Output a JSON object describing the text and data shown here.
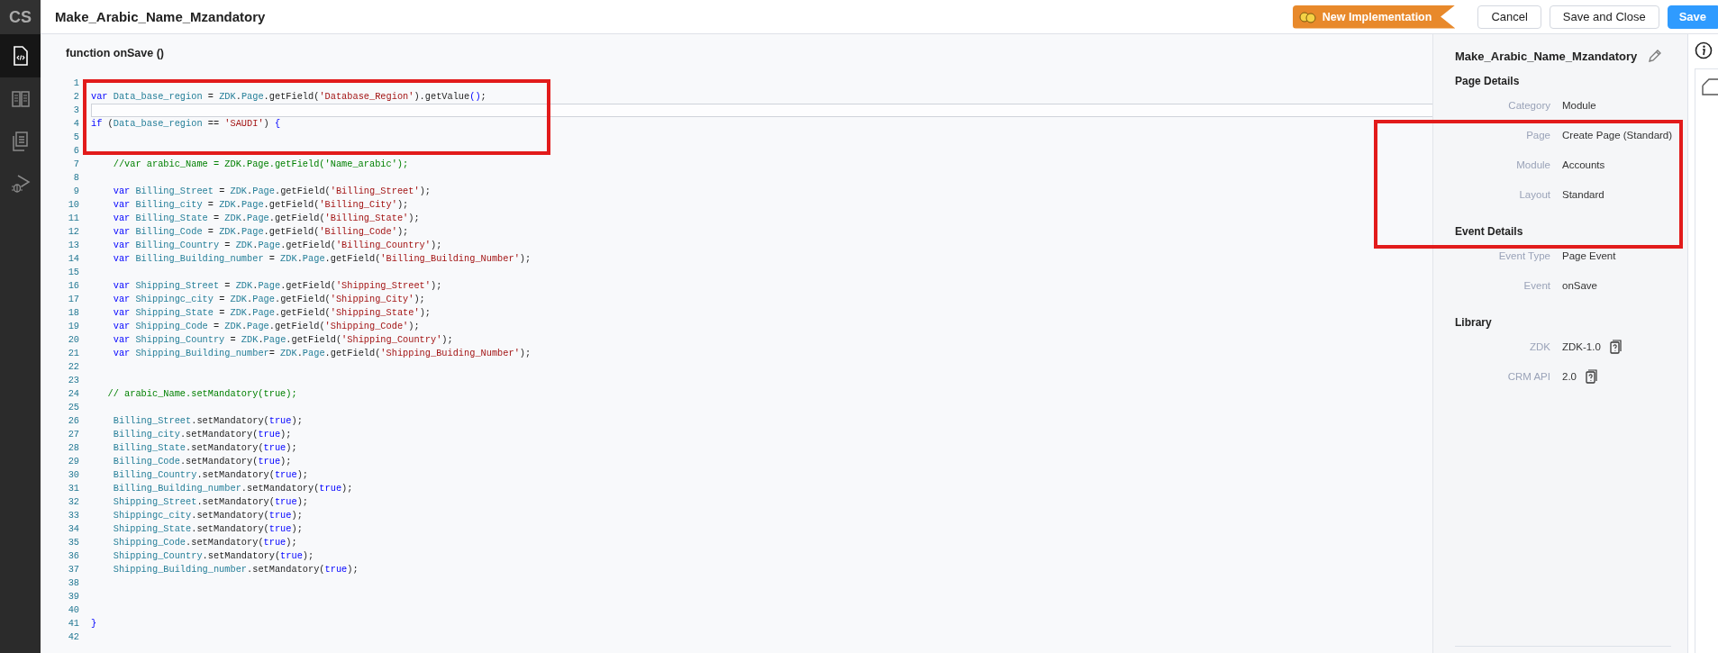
{
  "sidebar": {
    "logo": "CS",
    "items": [
      {
        "selected": true
      },
      {
        "selected": false
      },
      {
        "selected": false
      },
      {
        "selected": false
      }
    ]
  },
  "header": {
    "title": "Make_Arabic_Name_Mzandatory",
    "badge": "New Implementation",
    "buttons": [
      {
        "label": "Cancel",
        "kind": "secondary"
      },
      {
        "label": "Save and Close",
        "kind": "secondary"
      },
      {
        "label": "Save",
        "kind": "primary"
      }
    ]
  },
  "editor": {
    "signature": "function onSave ()",
    "lines": [
      {
        "number": "1",
        "active": false
      },
      {
        "number": "2",
        "active": false,
        "tokens": [
          {
            "kind": "keyword",
            "text": "var "
          },
          {
            "kind": "name",
            "text": "Data_base_region"
          },
          {
            "kind": "plain",
            "text": " = "
          },
          {
            "kind": "name",
            "text": "ZDK"
          },
          {
            "kind": "plain",
            "text": "."
          },
          {
            "kind": "name",
            "text": "Page"
          },
          {
            "kind": "plain",
            "text": ".getField("
          },
          {
            "kind": "string",
            "text": "'Database_Region'"
          },
          {
            "kind": "plain",
            "text": ").getValue"
          },
          {
            "kind": "keyword",
            "text": "()"
          },
          {
            "kind": "plain",
            "text": ";"
          }
        ]
      },
      {
        "number": "3",
        "active": true
      },
      {
        "number": "4",
        "active": false,
        "tokens": [
          {
            "kind": "keyword",
            "text": "if"
          },
          {
            "kind": "plain",
            "text": " ("
          },
          {
            "kind": "name",
            "text": "Data_base_region"
          },
          {
            "kind": "plain",
            "text": " == "
          },
          {
            "kind": "string",
            "text": "'SAUDI'"
          },
          {
            "kind": "plain",
            "text": ") "
          },
          {
            "kind": "keyword",
            "text": "{"
          }
        ]
      },
      {
        "number": "5",
        "active": false
      },
      {
        "number": "6",
        "active": false
      },
      {
        "number": "7",
        "active": false,
        "tokens": [
          {
            "kind": "comment",
            "text": "    //var arabic_Name = ZDK.Page.getField('Name_arabic');"
          }
        ]
      },
      {
        "number": "8",
        "active": false
      },
      {
        "number": "9",
        "active": false,
        "tokens": [
          {
            "kind": "keyword",
            "text": "    var "
          },
          {
            "kind": "name",
            "text": "Billing_Street"
          },
          {
            "kind": "plain",
            "text": " = "
          },
          {
            "kind": "name",
            "text": "ZDK"
          },
          {
            "kind": "plain",
            "text": "."
          },
          {
            "kind": "name",
            "text": "Page"
          },
          {
            "kind": "plain",
            "text": ".getField("
          },
          {
            "kind": "string",
            "text": "'Billing_Street'"
          },
          {
            "kind": "plain",
            "text": ");"
          }
        ]
      },
      {
        "number": "10",
        "active": false,
        "tokens": [
          {
            "kind": "keyword",
            "text": "    var "
          },
          {
            "kind": "name",
            "text": "Billing_city"
          },
          {
            "kind": "plain",
            "text": " = "
          },
          {
            "kind": "name",
            "text": "ZDK"
          },
          {
            "kind": "plain",
            "text": "."
          },
          {
            "kind": "name",
            "text": "Page"
          },
          {
            "kind": "plain",
            "text": ".getField("
          },
          {
            "kind": "string",
            "text": "'Billing_City'"
          },
          {
            "kind": "plain",
            "text": ");"
          }
        ]
      },
      {
        "number": "11",
        "active": false,
        "tokens": [
          {
            "kind": "keyword",
            "text": "    var "
          },
          {
            "kind": "name",
            "text": "Billing_State"
          },
          {
            "kind": "plain",
            "text": " = "
          },
          {
            "kind": "name",
            "text": "ZDK"
          },
          {
            "kind": "plain",
            "text": "."
          },
          {
            "kind": "name",
            "text": "Page"
          },
          {
            "kind": "plain",
            "text": ".getField("
          },
          {
            "kind": "string",
            "text": "'Billing_State'"
          },
          {
            "kind": "plain",
            "text": ");"
          }
        ]
      },
      {
        "number": "12",
        "active": false,
        "tokens": [
          {
            "kind": "keyword",
            "text": "    var "
          },
          {
            "kind": "name",
            "text": "Billing_Code"
          },
          {
            "kind": "plain",
            "text": " = "
          },
          {
            "kind": "name",
            "text": "ZDK"
          },
          {
            "kind": "plain",
            "text": "."
          },
          {
            "kind": "name",
            "text": "Page"
          },
          {
            "kind": "plain",
            "text": ".getField("
          },
          {
            "kind": "string",
            "text": "'Billing_Code'"
          },
          {
            "kind": "plain",
            "text": ");"
          }
        ]
      },
      {
        "number": "13",
        "active": false,
        "tokens": [
          {
            "kind": "keyword",
            "text": "    var "
          },
          {
            "kind": "name",
            "text": "Billing_Country"
          },
          {
            "kind": "plain",
            "text": " = "
          },
          {
            "kind": "name",
            "text": "ZDK"
          },
          {
            "kind": "plain",
            "text": "."
          },
          {
            "kind": "name",
            "text": "Page"
          },
          {
            "kind": "plain",
            "text": ".getField("
          },
          {
            "kind": "string",
            "text": "'Billing_Country'"
          },
          {
            "kind": "plain",
            "text": ");"
          }
        ]
      },
      {
        "number": "14",
        "active": false,
        "tokens": [
          {
            "kind": "keyword",
            "text": "    var "
          },
          {
            "kind": "name",
            "text": "Billing_Building_number"
          },
          {
            "kind": "plain",
            "text": " = "
          },
          {
            "kind": "name",
            "text": "ZDK"
          },
          {
            "kind": "plain",
            "text": "."
          },
          {
            "kind": "name",
            "text": "Page"
          },
          {
            "kind": "plain",
            "text": ".getField("
          },
          {
            "kind": "string",
            "text": "'Billing_Building_Number'"
          },
          {
            "kind": "plain",
            "text": ");"
          }
        ]
      },
      {
        "number": "15",
        "active": false
      },
      {
        "number": "16",
        "active": false,
        "tokens": [
          {
            "kind": "keyword",
            "text": "    var "
          },
          {
            "kind": "name",
            "text": "Shipping_Street"
          },
          {
            "kind": "plain",
            "text": " = "
          },
          {
            "kind": "name",
            "text": "ZDK"
          },
          {
            "kind": "plain",
            "text": "."
          },
          {
            "kind": "name",
            "text": "Page"
          },
          {
            "kind": "plain",
            "text": ".getField("
          },
          {
            "kind": "string",
            "text": "'Shipping_Street'"
          },
          {
            "kind": "plain",
            "text": ");"
          }
        ]
      },
      {
        "number": "17",
        "active": false,
        "tokens": [
          {
            "kind": "keyword",
            "text": "    var "
          },
          {
            "kind": "name",
            "text": "Shippingc_city"
          },
          {
            "kind": "plain",
            "text": " = "
          },
          {
            "kind": "name",
            "text": "ZDK"
          },
          {
            "kind": "plain",
            "text": "."
          },
          {
            "kind": "name",
            "text": "Page"
          },
          {
            "kind": "plain",
            "text": ".getField("
          },
          {
            "kind": "string",
            "text": "'Shipping_City'"
          },
          {
            "kind": "plain",
            "text": ");"
          }
        ]
      },
      {
        "number": "18",
        "active": false,
        "tokens": [
          {
            "kind": "keyword",
            "text": "    var "
          },
          {
            "kind": "name",
            "text": "Shipping_State"
          },
          {
            "kind": "plain",
            "text": " = "
          },
          {
            "kind": "name",
            "text": "ZDK"
          },
          {
            "kind": "plain",
            "text": "."
          },
          {
            "kind": "name",
            "text": "Page"
          },
          {
            "kind": "plain",
            "text": ".getField("
          },
          {
            "kind": "string",
            "text": "'Shipping_State'"
          },
          {
            "kind": "plain",
            "text": ");"
          }
        ]
      },
      {
        "number": "19",
        "active": false,
        "tokens": [
          {
            "kind": "keyword",
            "text": "    var "
          },
          {
            "kind": "name",
            "text": "Shipping_Code"
          },
          {
            "kind": "plain",
            "text": " = "
          },
          {
            "kind": "name",
            "text": "ZDK"
          },
          {
            "kind": "plain",
            "text": "."
          },
          {
            "kind": "name",
            "text": "Page"
          },
          {
            "kind": "plain",
            "text": ".getField("
          },
          {
            "kind": "string",
            "text": "'Shipping_Code'"
          },
          {
            "kind": "plain",
            "text": ");"
          }
        ]
      },
      {
        "number": "20",
        "active": false,
        "tokens": [
          {
            "kind": "keyword",
            "text": "    var "
          },
          {
            "kind": "name",
            "text": "Shipping_Country"
          },
          {
            "kind": "plain",
            "text": " = "
          },
          {
            "kind": "name",
            "text": "ZDK"
          },
          {
            "kind": "plain",
            "text": "."
          },
          {
            "kind": "name",
            "text": "Page"
          },
          {
            "kind": "plain",
            "text": ".getField("
          },
          {
            "kind": "string",
            "text": "'Shipping_Country'"
          },
          {
            "kind": "plain",
            "text": ");"
          }
        ]
      },
      {
        "number": "21",
        "active": false,
        "tokens": [
          {
            "kind": "keyword",
            "text": "    var "
          },
          {
            "kind": "name",
            "text": "Shipping_Building_number"
          },
          {
            "kind": "plain",
            "text": "= "
          },
          {
            "kind": "name",
            "text": "ZDK"
          },
          {
            "kind": "plain",
            "text": "."
          },
          {
            "kind": "name",
            "text": "Page"
          },
          {
            "kind": "plain",
            "text": ".getField("
          },
          {
            "kind": "string",
            "text": "'Shipping_Buiding_Number'"
          },
          {
            "kind": "plain",
            "text": ");"
          }
        ]
      },
      {
        "number": "22",
        "active": false
      },
      {
        "number": "23",
        "active": false
      },
      {
        "number": "24",
        "active": false,
        "tokens": [
          {
            "kind": "comment",
            "text": "   // arabic_Name.setMandatory(true);"
          }
        ]
      },
      {
        "number": "25",
        "active": false
      },
      {
        "number": "26",
        "active": false,
        "tokens": [
          {
            "kind": "name",
            "text": "    Billing_Street"
          },
          {
            "kind": "plain",
            "text": ".setMandatory("
          },
          {
            "kind": "keyword",
            "text": "true"
          },
          {
            "kind": "plain",
            "text": ");"
          }
        ]
      },
      {
        "number": "27",
        "active": false,
        "tokens": [
          {
            "kind": "name",
            "text": "    Billing_city"
          },
          {
            "kind": "plain",
            "text": ".setMandatory("
          },
          {
            "kind": "keyword",
            "text": "true"
          },
          {
            "kind": "plain",
            "text": ");"
          }
        ]
      },
      {
        "number": "28",
        "active": false,
        "tokens": [
          {
            "kind": "name",
            "text": "    Billing_State"
          },
          {
            "kind": "plain",
            "text": ".setMandatory("
          },
          {
            "kind": "keyword",
            "text": "true"
          },
          {
            "kind": "plain",
            "text": ");"
          }
        ]
      },
      {
        "number": "29",
        "active": false,
        "tokens": [
          {
            "kind": "name",
            "text": "    Billing_Code"
          },
          {
            "kind": "plain",
            "text": ".setMandatory("
          },
          {
            "kind": "keyword",
            "text": "true"
          },
          {
            "kind": "plain",
            "text": ");"
          }
        ]
      },
      {
        "number": "30",
        "active": false,
        "tokens": [
          {
            "kind": "name",
            "text": "    Billing_Country"
          },
          {
            "kind": "plain",
            "text": ".setMandatory("
          },
          {
            "kind": "keyword",
            "text": "true"
          },
          {
            "kind": "plain",
            "text": ");"
          }
        ]
      },
      {
        "number": "31",
        "active": false,
        "tokens": [
          {
            "kind": "name",
            "text": "    Billing_Building_number"
          },
          {
            "kind": "plain",
            "text": ".setMandatory("
          },
          {
            "kind": "keyword",
            "text": "true"
          },
          {
            "kind": "plain",
            "text": ");"
          }
        ]
      },
      {
        "number": "32",
        "active": false,
        "tokens": [
          {
            "kind": "name",
            "text": "    Shipping_Street"
          },
          {
            "kind": "plain",
            "text": ".setMandatory("
          },
          {
            "kind": "keyword",
            "text": "true"
          },
          {
            "kind": "plain",
            "text": ");"
          }
        ]
      },
      {
        "number": "33",
        "active": false,
        "tokens": [
          {
            "kind": "name",
            "text": "    Shippingc_city"
          },
          {
            "kind": "plain",
            "text": ".setMandatory("
          },
          {
            "kind": "keyword",
            "text": "true"
          },
          {
            "kind": "plain",
            "text": ");"
          }
        ]
      },
      {
        "number": "34",
        "active": false,
        "tokens": [
          {
            "kind": "name",
            "text": "    Shipping_State"
          },
          {
            "kind": "plain",
            "text": ".setMandatory("
          },
          {
            "kind": "keyword",
            "text": "true"
          },
          {
            "kind": "plain",
            "text": ");"
          }
        ]
      },
      {
        "number": "35",
        "active": false,
        "tokens": [
          {
            "kind": "name",
            "text": "    Shipping_Code"
          },
          {
            "kind": "plain",
            "text": ".setMandatory("
          },
          {
            "kind": "keyword",
            "text": "true"
          },
          {
            "kind": "plain",
            "text": ");"
          }
        ]
      },
      {
        "number": "36",
        "active": false,
        "tokens": [
          {
            "kind": "name",
            "text": "    Shipping_Country"
          },
          {
            "kind": "plain",
            "text": ".setMandatory("
          },
          {
            "kind": "keyword",
            "text": "true"
          },
          {
            "kind": "plain",
            "text": ");"
          }
        ]
      },
      {
        "number": "37",
        "active": false,
        "tokens": [
          {
            "kind": "name",
            "text": "    Shipping_Building_number"
          },
          {
            "kind": "plain",
            "text": ".setMandatory("
          },
          {
            "kind": "keyword",
            "text": "true"
          },
          {
            "kind": "plain",
            "text": ");"
          }
        ]
      },
      {
        "number": "38",
        "active": false
      },
      {
        "number": "39",
        "active": false
      },
      {
        "number": "40",
        "active": false
      },
      {
        "number": "41",
        "active": false,
        "tokens": [
          {
            "kind": "keyword",
            "text": "}"
          }
        ]
      },
      {
        "number": "42",
        "active": false
      }
    ]
  },
  "panel": {
    "title": "Make_Arabic_Name_Mzandatory",
    "sections": [
      {
        "heading": "Page Details",
        "rows": [
          {
            "label": "Category",
            "value": "Module",
            "kind": "plain"
          },
          {
            "label": "Page",
            "value": "Create Page (Standard)",
            "kind": "plain"
          },
          {
            "label": "Module",
            "value": "Accounts",
            "kind": "plain"
          },
          {
            "label": "Layout",
            "value": "Standard",
            "kind": "plain"
          }
        ]
      },
      {
        "heading": "Event Details",
        "rows": [
          {
            "label": "Event Type",
            "value": "Page Event",
            "kind": "plain"
          },
          {
            "label": "Event",
            "value": "onSave",
            "kind": "plain"
          }
        ]
      },
      {
        "heading": "Library",
        "rows": [
          {
            "label": "ZDK",
            "value": "ZDK-1.0",
            "kind": "doc"
          },
          {
            "label": "CRM API",
            "value": "2.0",
            "kind": "doc"
          }
        ]
      }
    ]
  },
  "annotations": [
    {
      "kind": "box"
    },
    {
      "kind": "box"
    }
  ]
}
